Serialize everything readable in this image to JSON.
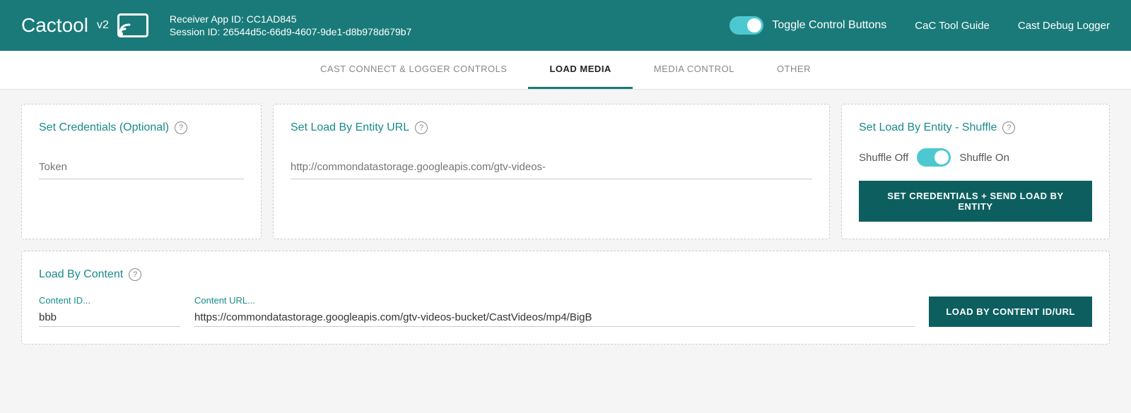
{
  "header": {
    "logo_text": "Cactool",
    "logo_v2": "v2",
    "receiver_app_id_label": "Receiver App ID: CC1AD845",
    "session_id_label": "Session ID: 26544d5c-66d9-4607-9de1-d8b978d679b7",
    "toggle_label": "Toggle Control Buttons",
    "nav_guide": "CaC Tool Guide",
    "nav_logger": "Cast Debug Logger",
    "accent_color": "#1a7a7a"
  },
  "tabs": [
    {
      "id": "cast-connect",
      "label": "CAST CONNECT & LOGGER CONTROLS",
      "active": false
    },
    {
      "id": "load-media",
      "label": "LOAD MEDIA",
      "active": true
    },
    {
      "id": "media-control",
      "label": "MEDIA CONTROL",
      "active": false
    },
    {
      "id": "other",
      "label": "OTHER",
      "active": false
    }
  ],
  "sections": {
    "credentials": {
      "title": "Set Credentials (Optional)",
      "token_placeholder": "Token"
    },
    "entity_url": {
      "title": "Set Load By Entity URL",
      "url_placeholder": "http://commondatastorage.googleapis.com/gtv-videos-"
    },
    "shuffle": {
      "title": "Set Load By Entity - Shuffle",
      "shuffle_off_label": "Shuffle Off",
      "shuffle_on_label": "Shuffle On",
      "button_label": "SET CREDENTIALS + SEND LOAD BY ENTITY"
    },
    "load_content": {
      "title": "Load By Content",
      "content_id_label": "Content ID...",
      "content_id_value": "bbb",
      "content_url_label": "Content URL...",
      "content_url_value": "https://commondatastorage.googleapis.com/gtv-videos-bucket/CastVideos/mp4/BigB",
      "button_label": "LOAD BY CONTENT ID/URL"
    }
  }
}
